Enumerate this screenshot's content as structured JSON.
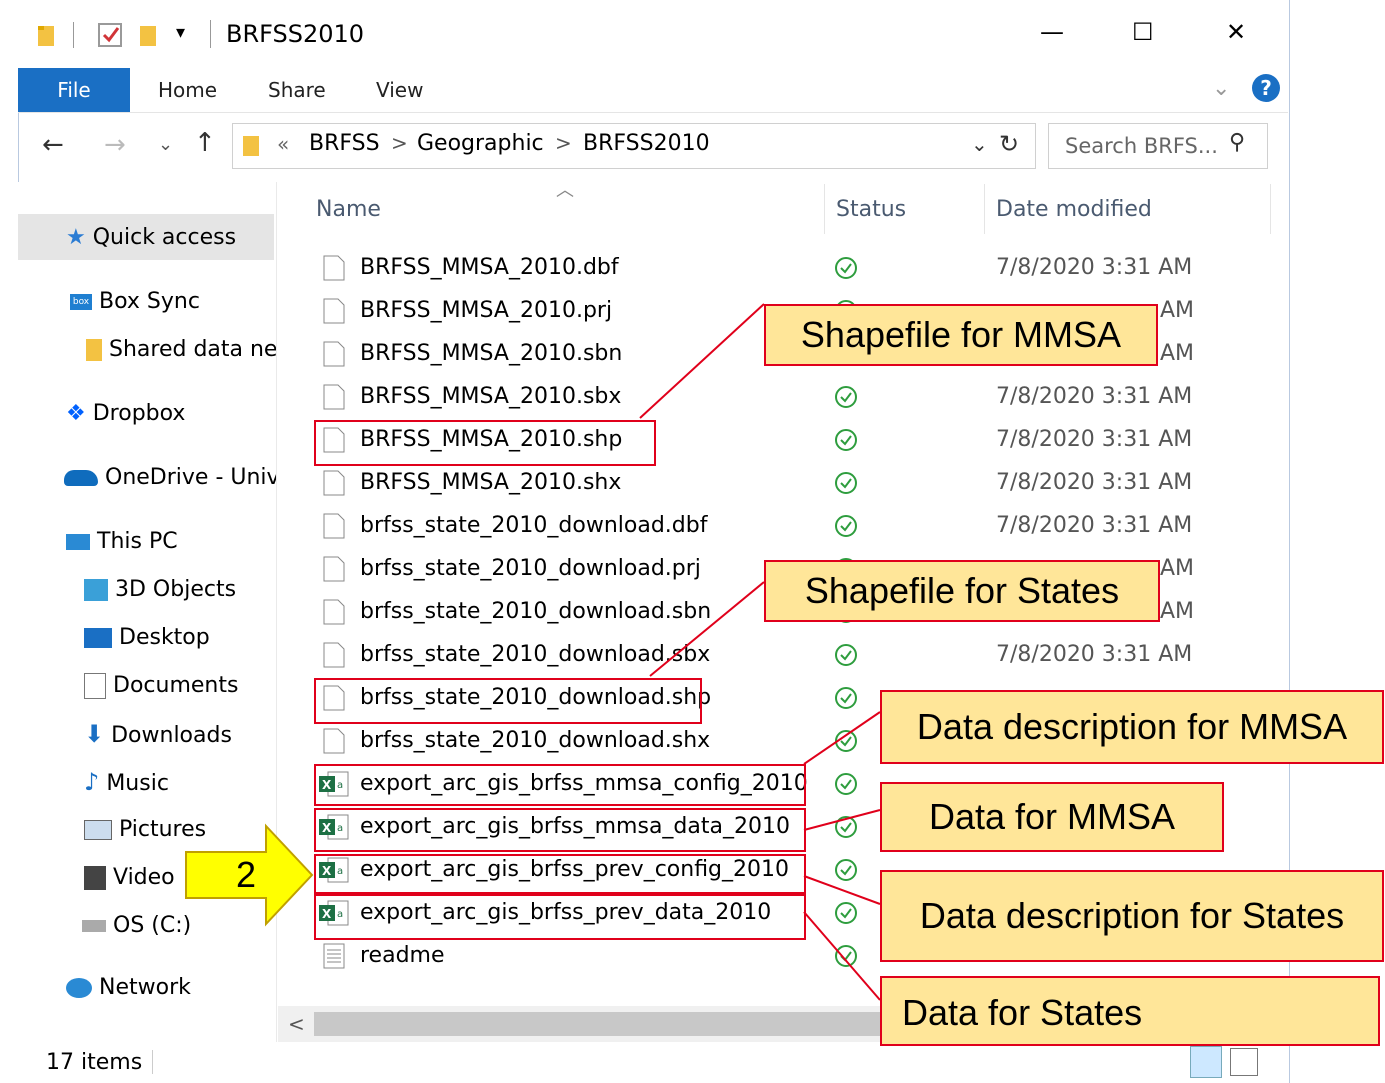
{
  "titlebar": {
    "title": "BRFSS2010",
    "minimize": "—",
    "maximize": "☐",
    "close": "✕"
  },
  "ribbon": {
    "file": "File",
    "home": "Home",
    "share": "Share",
    "view": "View"
  },
  "address": {
    "prefix": "«",
    "crumbs": [
      "BRFSS",
      "Geographic",
      "BRFSS2010"
    ],
    "sep": ">"
  },
  "search": {
    "placeholder": "Search BRFS..."
  },
  "columns": {
    "name": "Name",
    "status": "Status",
    "date": "Date modified"
  },
  "nav": [
    {
      "label": "Quick access",
      "icon": "star-icon"
    },
    {
      "label": "Box Sync",
      "icon": "box-icon"
    },
    {
      "label": "Shared data ne",
      "icon": "folder-icon"
    },
    {
      "label": "Dropbox",
      "icon": "dropbox-icon"
    },
    {
      "label": "OneDrive - Univ",
      "icon": "cloud-icon"
    },
    {
      "label": "This PC",
      "icon": "pc-icon"
    },
    {
      "label": "3D Objects",
      "icon": "cube-icon"
    },
    {
      "label": "Desktop",
      "icon": "desktop-icon"
    },
    {
      "label": "Documents",
      "icon": "documents-icon"
    },
    {
      "label": "Downloads",
      "icon": "download-icon"
    },
    {
      "label": "Music",
      "icon": "music-icon"
    },
    {
      "label": "Pictures",
      "icon": "pictures-icon"
    },
    {
      "label": "Video",
      "icon": "video-icon"
    },
    {
      "label": "OS (C:)",
      "icon": "drive-icon"
    },
    {
      "label": "Network",
      "icon": "network-icon"
    }
  ],
  "files": [
    {
      "name": "BRFSS_MMSA_2010.dbf",
      "date": "7/8/2020 3:31 AM",
      "type": "file"
    },
    {
      "name": "BRFSS_MMSA_2010.prj",
      "date": "AM",
      "type": "file"
    },
    {
      "name": "BRFSS_MMSA_2010.sbn",
      "date": "AM",
      "type": "file"
    },
    {
      "name": "BRFSS_MMSA_2010.sbx",
      "date": "7/8/2020 3:31 AM",
      "type": "file"
    },
    {
      "name": "BRFSS_MMSA_2010.shp",
      "date": "7/8/2020 3:31 AM",
      "type": "file"
    },
    {
      "name": "BRFSS_MMSA_2010.shx",
      "date": "7/8/2020 3:31 AM",
      "type": "file"
    },
    {
      "name": "brfss_state_2010_download.dbf",
      "date": "7/8/2020 3:31 AM",
      "type": "file"
    },
    {
      "name": "brfss_state_2010_download.prj",
      "date": "AM",
      "type": "file"
    },
    {
      "name": "brfss_state_2010_download.sbn",
      "date": "AM",
      "type": "file"
    },
    {
      "name": "brfss_state_2010_download.sbx",
      "date": "7/8/2020 3:31 AM",
      "type": "file"
    },
    {
      "name": "brfss_state_2010_download.shp",
      "date": "",
      "type": "file"
    },
    {
      "name": "brfss_state_2010_download.shx",
      "date": "",
      "type": "file"
    },
    {
      "name": "export_arc_gis_brfss_mmsa_config_2010",
      "date": "",
      "type": "excel"
    },
    {
      "name": "export_arc_gis_brfss_mmsa_data_2010",
      "date": "",
      "type": "excel"
    },
    {
      "name": "export_arc_gis_brfss_prev_config_2010",
      "date": "",
      "type": "excel"
    },
    {
      "name": "export_arc_gis_brfss_prev_data_2010",
      "date": "",
      "type": "excel"
    },
    {
      "name": "readme",
      "date": "",
      "type": "text"
    }
  ],
  "callouts": {
    "mmsa_shape": "Shapefile for MMSA",
    "states_shape": "Shapefile for States",
    "mmsa_desc": "Data description for MMSA",
    "mmsa_data": "Data for MMSA",
    "states_desc": "Data description for States",
    "states_data": "Data for States",
    "step": "2"
  },
  "status": {
    "count": "17 items"
  },
  "colors": {
    "accent": "#1a6fc4",
    "callout_fill": "#ffe699",
    "callout_border": "#e0001b",
    "arrow": "#ffff00"
  }
}
